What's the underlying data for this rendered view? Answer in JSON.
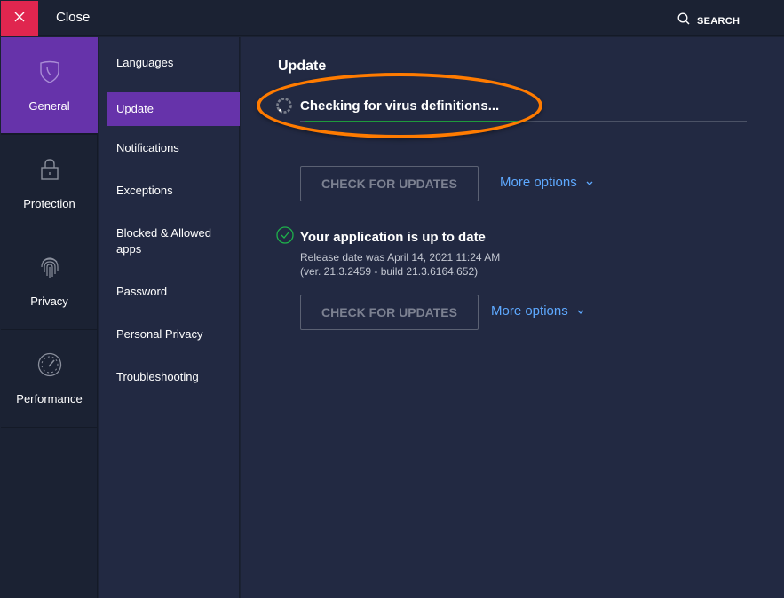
{
  "titlebar": {
    "close_label": "Close",
    "search_label": "SEARCH",
    "close_icon": "close-x-icon",
    "search_icon": "search-icon"
  },
  "rail": {
    "items": [
      {
        "label": "General",
        "icon": "shield-icon",
        "active": true
      },
      {
        "label": "Protection",
        "icon": "lock-icon",
        "active": false
      },
      {
        "label": "Privacy",
        "icon": "fingerprint-icon",
        "active": false
      },
      {
        "label": "Performance",
        "icon": "speedometer-icon",
        "active": false
      }
    ]
  },
  "submenu": {
    "items": [
      {
        "label": "Languages",
        "active": false
      },
      {
        "label": "Update",
        "active": true
      },
      {
        "label": "Notifications",
        "active": false
      },
      {
        "label": "Exceptions",
        "active": false
      },
      {
        "label": "Blocked & Allowed apps",
        "active": false
      },
      {
        "label": "Password",
        "active": false
      },
      {
        "label": "Personal Privacy",
        "active": false
      },
      {
        "label": "Troubleshooting",
        "active": false
      }
    ]
  },
  "main": {
    "title": "Update",
    "virus_definitions": {
      "status_text": "Checking for virus definitions...",
      "progress_percent": 50,
      "check_button_label": "CHECK FOR UPDATES",
      "more_options_label": "More options"
    },
    "application": {
      "status_text": "Your application is up to date",
      "release_date_text": "Release date was April 14, 2021 11:24 AM",
      "version_text": "(ver. 21.3.2459 - build 21.3.6164.652)",
      "check_button_label": "CHECK FOR UPDATES",
      "more_options_label": "More options"
    }
  },
  "colors": {
    "close_red": "#e0264f",
    "active_purple": "#6633aa",
    "progress_green": "#1e9b3c",
    "link_blue": "#5ea9ff",
    "annotation_orange": "#ff7b00"
  }
}
